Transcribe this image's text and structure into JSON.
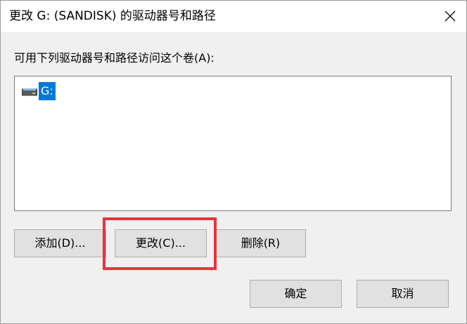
{
  "dialog": {
    "title": "更改 G: (SANDISK) 的驱动器号和路径",
    "close_icon": "close-icon"
  },
  "instruction": "可用下列驱动器号和路径访问这个卷(A):",
  "list": {
    "items": [
      {
        "label": "G:",
        "icon": "drive-icon",
        "selected": true
      }
    ]
  },
  "buttons": {
    "add": "添加(D)...",
    "change": "更改(C)...",
    "delete": "删除(R)",
    "ok": "确定",
    "cancel": "取消"
  },
  "colors": {
    "selection": "#0078d7",
    "highlight": "#e8343a"
  }
}
